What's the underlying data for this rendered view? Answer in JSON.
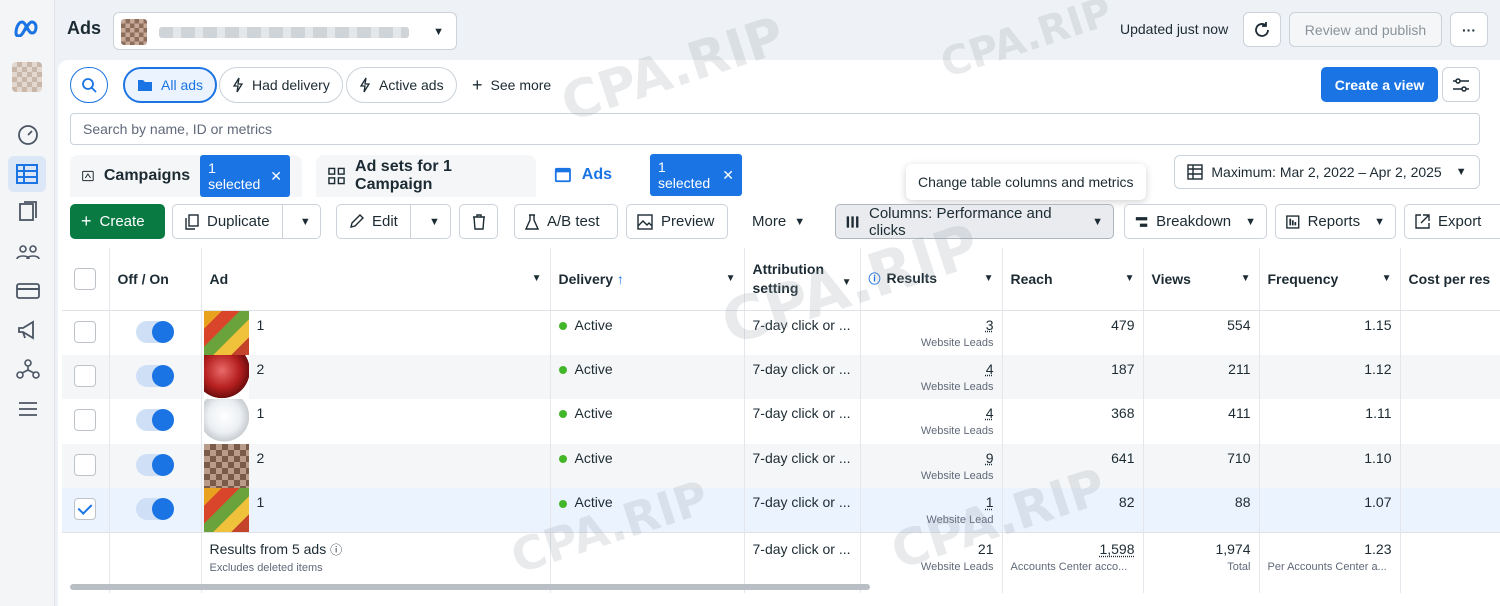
{
  "app": {
    "title": "Ads"
  },
  "header": {
    "updated": "Updated just now",
    "review_publish": "Review and publish",
    "more_label": "···"
  },
  "filters": {
    "all_ads": "All ads",
    "had_delivery": "Had delivery",
    "active_ads": "Active ads",
    "see_more": "See more",
    "create_view": "Create a view",
    "search_placeholder": "Search by name, ID or metrics"
  },
  "tabs": [
    {
      "label": "Campaigns",
      "badge": "1 selected"
    },
    {
      "label": "Ad sets for 1 Campaign"
    },
    {
      "label": "Ads",
      "badge": "1 selected"
    }
  ],
  "tooltip": "Change table columns and metrics",
  "date_range": "Maximum: Mar 2, 2022 – Apr 2, 2025",
  "toolbar": {
    "create": "Create",
    "duplicate": "Duplicate",
    "edit": "Edit",
    "ab_test": "A/B test",
    "preview": "Preview",
    "more": "More",
    "columns": "Columns: Performance and clicks",
    "breakdown": "Breakdown",
    "reports": "Reports",
    "export": "Export"
  },
  "columns": [
    "Off / On",
    "Ad",
    "Delivery",
    "Attribution setting",
    "Results",
    "Reach",
    "Views",
    "Frequency",
    "Cost per res"
  ],
  "rows": [
    {
      "ad": "1",
      "delivery": "Active",
      "attribution": "7-day click or ...",
      "results": "3",
      "results_sub": "Website Leads",
      "reach": "479",
      "views": "554",
      "frequency": "1.15",
      "checked": false,
      "thumb": "fruit"
    },
    {
      "ad": "2",
      "delivery": "Active",
      "attribution": "7-day click or ...",
      "results": "4",
      "results_sub": "Website Leads",
      "reach": "187",
      "views": "211",
      "frequency": "1.12",
      "checked": false,
      "thumb": "red"
    },
    {
      "ad": "1",
      "delivery": "Active",
      "attribution": "7-day click or ...",
      "results": "4",
      "results_sub": "Website Leads",
      "reach": "368",
      "views": "411",
      "frequency": "1.11",
      "checked": false,
      "thumb": "white"
    },
    {
      "ad": "2",
      "delivery": "Active",
      "attribution": "7-day click or ...",
      "results": "9",
      "results_sub": "Website Leads",
      "reach": "641",
      "views": "710",
      "frequency": "1.10",
      "checked": false,
      "thumb": "blur"
    },
    {
      "ad": "1",
      "delivery": "Active",
      "attribution": "7-day click or ...",
      "results": "1",
      "results_sub": "Website Lead",
      "reach": "82",
      "views": "88",
      "frequency": "1.07",
      "checked": true,
      "thumb": "fruit"
    }
  ],
  "totals": {
    "label": "Results from 5 ads",
    "sub": "Excludes deleted items",
    "attribution": "7-day click or ...",
    "results": "21",
    "results_sub": "Website Leads",
    "reach": "1,598",
    "reach_sub": "Accounts Center acco...",
    "views": "1,974",
    "views_sub": "Total",
    "frequency": "1.23",
    "frequency_sub": "Per Accounts Center a..."
  },
  "watermark": "CPA.RIP",
  "colors": {
    "accent": "#1b74e4",
    "create": "#0a7a43",
    "active_dot": "#42b72a"
  }
}
